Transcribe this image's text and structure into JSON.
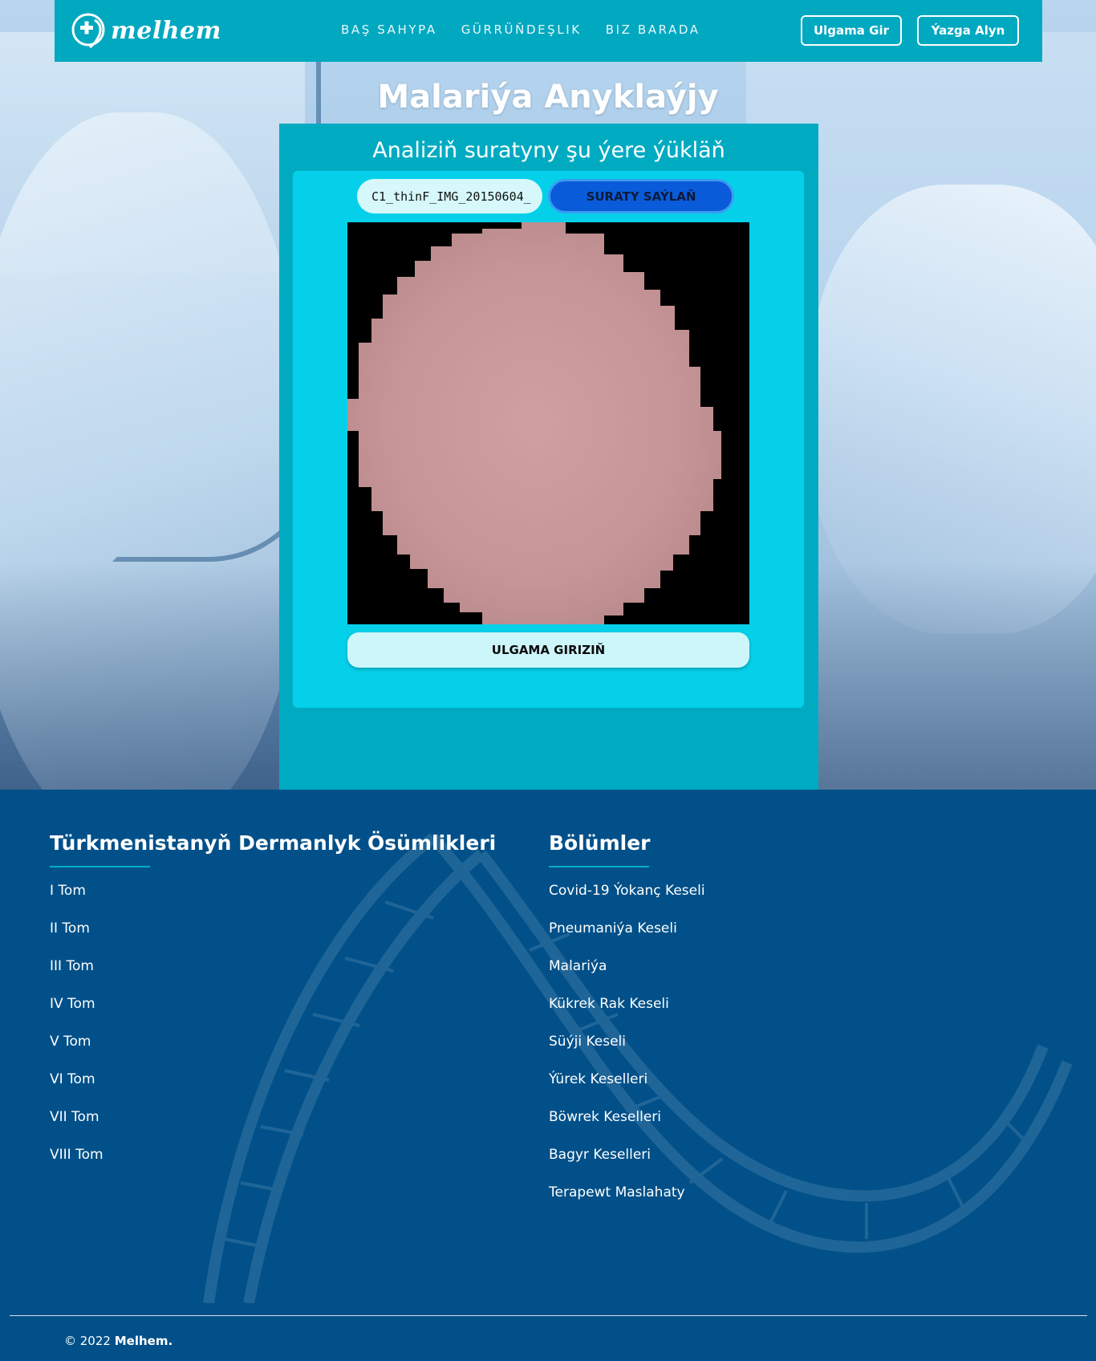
{
  "nav": {
    "logo_text": "melhem",
    "links": [
      "BAŞ SAHYPA",
      "GÜRRÜŇDEŞLIK",
      "BIZ BARADA"
    ],
    "login_label": "Ulgama Gir",
    "register_label": "Ýazga Alyn"
  },
  "main": {
    "title": "Malariýa Anyklaýjy",
    "panel_title": "Analiziň suratyny şu ýere ýükläň",
    "file_name": "C1_thinF_IMG_20150604_",
    "choose_label": "SURATY SAÝLAŇ",
    "submit_label": "ULGAMA GIRIZIŇ"
  },
  "footer": {
    "left_heading": "Türkmenistanyň Dermanlyk Ösümlikleri",
    "left_items": [
      "I Tom",
      "II Tom",
      "III Tom",
      "IV Tom",
      "V Tom",
      "VI Tom",
      "VII Tom",
      "VIII Tom"
    ],
    "right_heading": "Bölümler",
    "right_items": [
      "Covid-19 Ýokanç Keseli",
      "Pneumaniýa Keseli",
      "Malariýa",
      "Kükrek Rak Keseli",
      "Süýji Keseli",
      "Ýürek Keselleri",
      "Böwrek Keselleri",
      "Bagyr Keselleri",
      "Terapewt Maslahaty"
    ],
    "copyright_prefix": "© 2022",
    "copyright_brand": "Melhem."
  },
  "colors": {
    "nav_bg": "#00a8c0",
    "panel_bg": "#00abc2",
    "inner_bg": "#05d0ea",
    "choose_btn": "#0a5bd9",
    "footer_bg": "#015089",
    "cell_color": "#c9989a"
  },
  "icons": [
    "logo-cross-heart-icon"
  ]
}
